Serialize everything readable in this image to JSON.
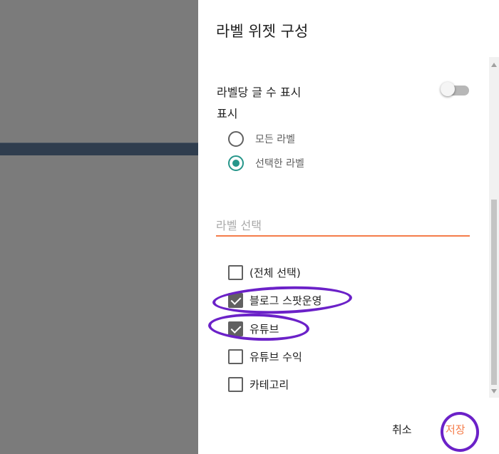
{
  "dialog": {
    "title": "라벨 위젯 구성",
    "show_count_label": "라벨당 글 수 표시",
    "show_count_enabled": false,
    "display_label": "표시",
    "display_options": [
      {
        "label": "모든 라벨",
        "selected": false
      },
      {
        "label": "선택한 라벨",
        "selected": true
      }
    ],
    "label_select_placeholder": "라벨 선택",
    "labels": [
      {
        "label": "(전체 선택)",
        "checked": false
      },
      {
        "label": "블로그 스팟운영",
        "checked": true
      },
      {
        "label": "유튜브",
        "checked": true
      },
      {
        "label": "유튜브 수익",
        "checked": false
      },
      {
        "label": "카테고리",
        "checked": false
      }
    ],
    "cancel_label": "취소",
    "save_label": "저장"
  },
  "colors": {
    "accent": "#f57c4a",
    "radio_selected": "#26968a",
    "annotation": "#6b21c8",
    "backdrop": "#7b7b7b"
  }
}
